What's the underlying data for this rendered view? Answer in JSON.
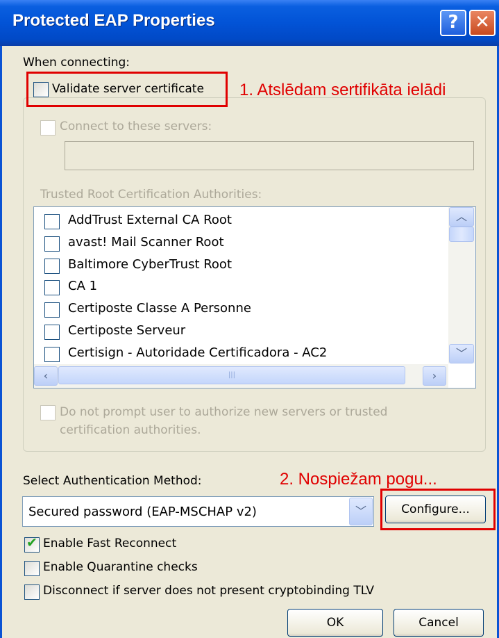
{
  "window": {
    "title": "Protected EAP Properties",
    "help_glyph": "?",
    "close_glyph": "✕"
  },
  "when_connecting": "When connecting:",
  "validate_cert": {
    "label": "Validate server certificate",
    "checked": false
  },
  "connect_servers": {
    "label": "Connect to these servers:",
    "value": ""
  },
  "trusted_root_label": "Trusted Root Certification Authorities:",
  "cert_list": [
    "AddTrust External CA Root",
    "avast! Mail Scanner Root",
    "Baltimore CyberTrust Root",
    "CA 1",
    "Certiposte Classe A Personne",
    "Certiposte Serveur",
    "Certisign - Autoridade Certificadora - AC2"
  ],
  "scroll_glyphs": {
    "up": "︿",
    "down": "﹀",
    "left": "‹",
    "right": "›",
    "grip": "|||"
  },
  "do_not_prompt": "Do not prompt user to authorize new servers or trusted certification authorities.",
  "auth_method_label": "Select Authentication Method:",
  "auth_method_value": "Secured password (EAP-MSCHAP v2)",
  "configure_label": "Configure...",
  "options": [
    {
      "label": "Enable Fast Reconnect",
      "checked": true
    },
    {
      "label": "Enable Quarantine checks",
      "checked": false
    },
    {
      "label": "Disconnect if server does not present cryptobinding TLV",
      "checked": false
    }
  ],
  "ok_label": "OK",
  "cancel_label": "Cancel",
  "annotations": {
    "step1": "1. Atslēdam sertifikāta ielādi",
    "step2": "2. Nospiežam pogu..."
  },
  "colors": {
    "title_bar": "#0253d6",
    "annotation": "#e00000",
    "check": "#21a121"
  }
}
